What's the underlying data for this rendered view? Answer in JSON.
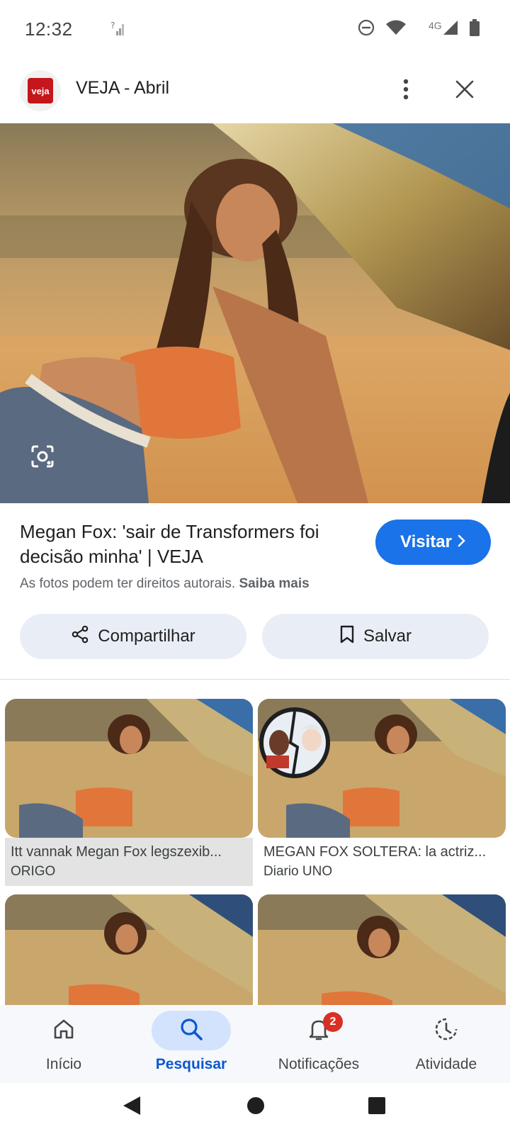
{
  "status_bar": {
    "time": "12:32",
    "network_label": "4G",
    "icons": [
      "signal-unknown-icon",
      "do-not-disturb-icon",
      "wifi-icon",
      "cell-signal-icon",
      "battery-icon"
    ]
  },
  "header": {
    "logo_text": "veja",
    "title": "VEJA - Abril",
    "icons": [
      "more-vert-icon",
      "close-icon"
    ]
  },
  "result": {
    "title": "Megan Fox: 'sair de Transformers foi decisão minha' | VEJA",
    "visit_label": "Visitar",
    "copyright_text": "As fotos podem ter direitos autorais.",
    "copyright_link": "Saiba mais",
    "share_label": "Compartilhar",
    "save_label": "Salvar"
  },
  "related": [
    {
      "title": "Itt vannak Megan Fox legszexib...",
      "source": "ORIGO"
    },
    {
      "title": "MEGAN FOX SOLTERA: la actriz...",
      "source": "Diario UNO"
    },
    {
      "title": "",
      "source": ""
    },
    {
      "title": "",
      "source": ""
    }
  ],
  "bottom_nav": {
    "items": [
      {
        "label": "Início",
        "icon": "home-icon"
      },
      {
        "label": "Pesquisar",
        "icon": "search-icon"
      },
      {
        "label": "Notificações",
        "icon": "bell-icon",
        "badge": "2"
      },
      {
        "label": "Atividade",
        "icon": "activity-icon"
      }
    ],
    "active": "Pesquisar"
  },
  "colors": {
    "accent": "#1a73e8",
    "active_nav": "#0b57d0",
    "badge": "#d93025",
    "chip_bg": "#e9eef6"
  }
}
